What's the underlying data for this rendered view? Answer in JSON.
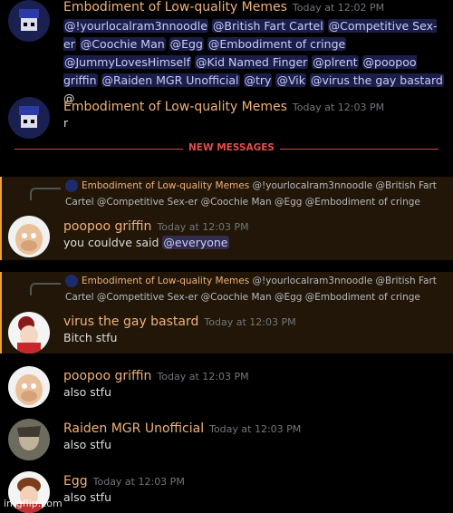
{
  "messages": [
    {
      "author": "Embodiment of Low-quality Memes",
      "timestamp": "Today at 12:02 PM",
      "mentions": [
        "@!yourlocalram3nnoodle",
        "@British Fart Cartel",
        "@Competitive Sex-er",
        "@Coochie Man",
        "@Egg",
        "@Embodiment of cringe",
        "@JummyLovesHimself",
        "@Kid Named Finger",
        "@plrent",
        "@poopoo griffin",
        "@Raiden MGR Unofficial",
        "@try",
        "@Vik",
        "@virus the gay bastard"
      ],
      "trailing": "@"
    },
    {
      "author": "Embodiment of Low-quality Memes",
      "timestamp": "Today at 12:03 PM",
      "text": "r"
    }
  ],
  "divider": {
    "label": "NEW MESSAGES"
  },
  "replies": [
    {
      "ref_author": "Embodiment of Low-quality Memes",
      "ref_text": "@!yourlocalram3nnoodle @British Fart Cartel @Competitive Sex-er @Coochie Man @Egg @Embodiment of cringe",
      "author": "poopoo griffin",
      "timestamp": "Today at 12:03 PM",
      "text": "you couldve said",
      "mention": "@everyone"
    },
    {
      "ref_author": "Embodiment of Low-quality Memes",
      "ref_text": "@!yourlocalram3nnoodle @British Fart Cartel @Competitive Sex-er @Coochie Man @Egg @Embodiment of cringe",
      "author": "virus the gay bastard",
      "timestamp": "Today at 12:03 PM",
      "text": "Bitch stfu"
    }
  ],
  "plain": [
    {
      "author": "poopoo griffin",
      "timestamp": "Today at 12:03 PM",
      "text": "also stfu"
    },
    {
      "author": "Raiden MGR Unofficial",
      "timestamp": "Today at 12:03 PM",
      "text": "also stfu"
    },
    {
      "author": "Egg",
      "timestamp": "Today at 12:03 PM",
      "text": "also stfu"
    }
  ],
  "watermark": "imgflip.com"
}
